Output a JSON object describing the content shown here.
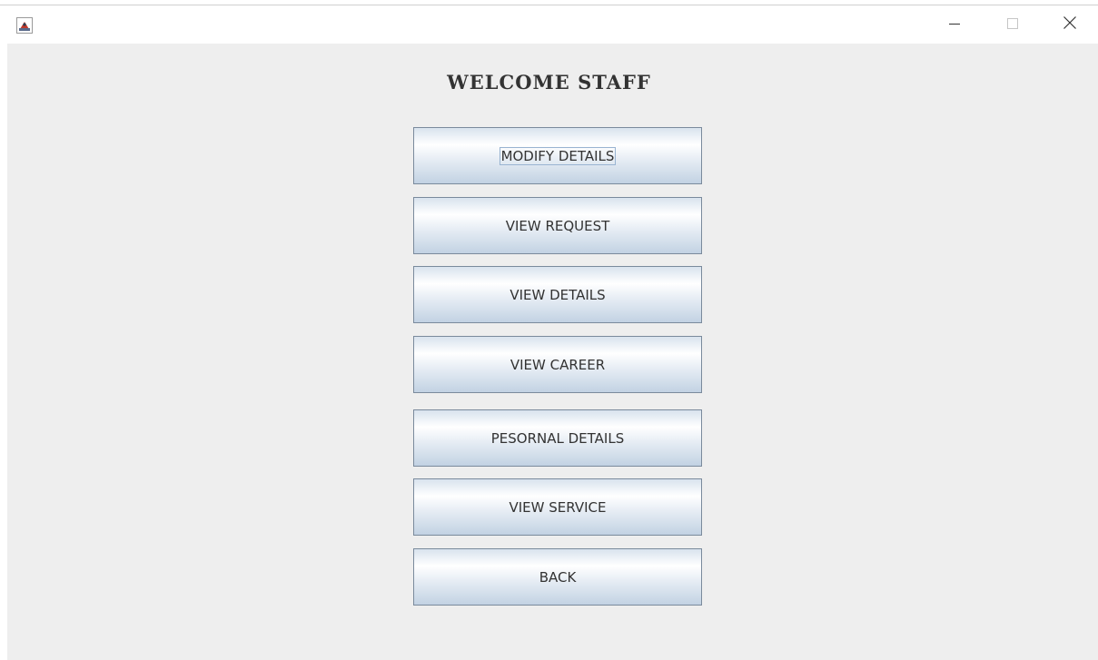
{
  "window": {
    "app_icon": "java-cup-icon",
    "controls": {
      "minimize_icon": "minimize-icon",
      "maximize_icon": "maximize-icon",
      "close_icon": "close-icon"
    }
  },
  "main": {
    "heading": "WELCOME STAFF",
    "buttons": [
      {
        "label": "MODIFY DETAILS"
      },
      {
        "label": "VIEW REQUEST"
      },
      {
        "label": "VIEW DETAILS"
      },
      {
        "label": "VIEW CAREER"
      },
      {
        "label": "PESORNAL DETAILS"
      },
      {
        "label": "VIEW SERVICE"
      },
      {
        "label": "BACK"
      }
    ]
  },
  "colors": {
    "background": "#eeeeee",
    "button_border": "#7a8a9c",
    "button_gradient_bottom": "#c2d2e3",
    "focus_ring": "#99b4d1",
    "text": "#333333"
  }
}
